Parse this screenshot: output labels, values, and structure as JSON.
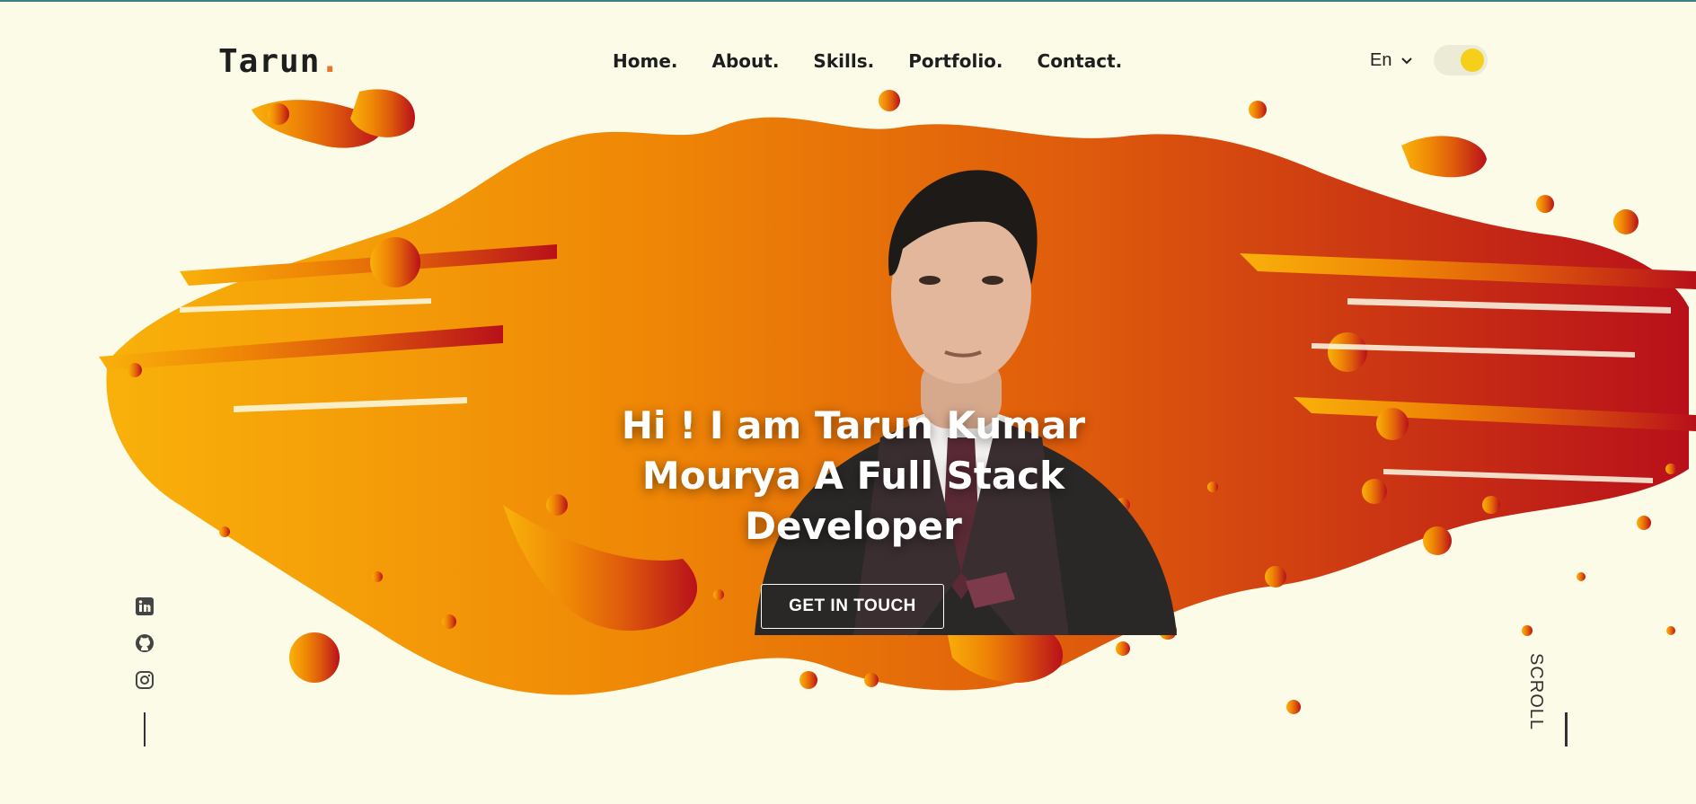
{
  "brand": {
    "name": "Tarun",
    "dot": ".",
    "dot_color": "#e8752a"
  },
  "nav": {
    "items": [
      {
        "label": "Home."
      },
      {
        "label": "About."
      },
      {
        "label": "Skills."
      },
      {
        "label": "Portfolio."
      },
      {
        "label": "Contact."
      }
    ]
  },
  "language": {
    "label": "En",
    "icon": "chevron-down-icon"
  },
  "theme_toggle": {
    "state": "on",
    "knob_color": "#f6cf1b"
  },
  "hero": {
    "headline": "Hi ! I am Tarun Kumar Mourya A Full Stack Developer",
    "cta_label": "GET IN TOUCH",
    "splash_gradient": [
      "#f9b10a",
      "#ef7d05",
      "#d9470f",
      "#b8101a"
    ]
  },
  "social": [
    {
      "name": "LinkedIn",
      "icon": "linkedin-icon"
    },
    {
      "name": "GitHub",
      "icon": "github-icon"
    },
    {
      "name": "Instagram",
      "icon": "instagram-icon"
    }
  ],
  "scroll_label": "SCROLL",
  "colors": {
    "background": "#fbfbe8",
    "text": "#1e1e1e",
    "accent": "#e8752a"
  }
}
